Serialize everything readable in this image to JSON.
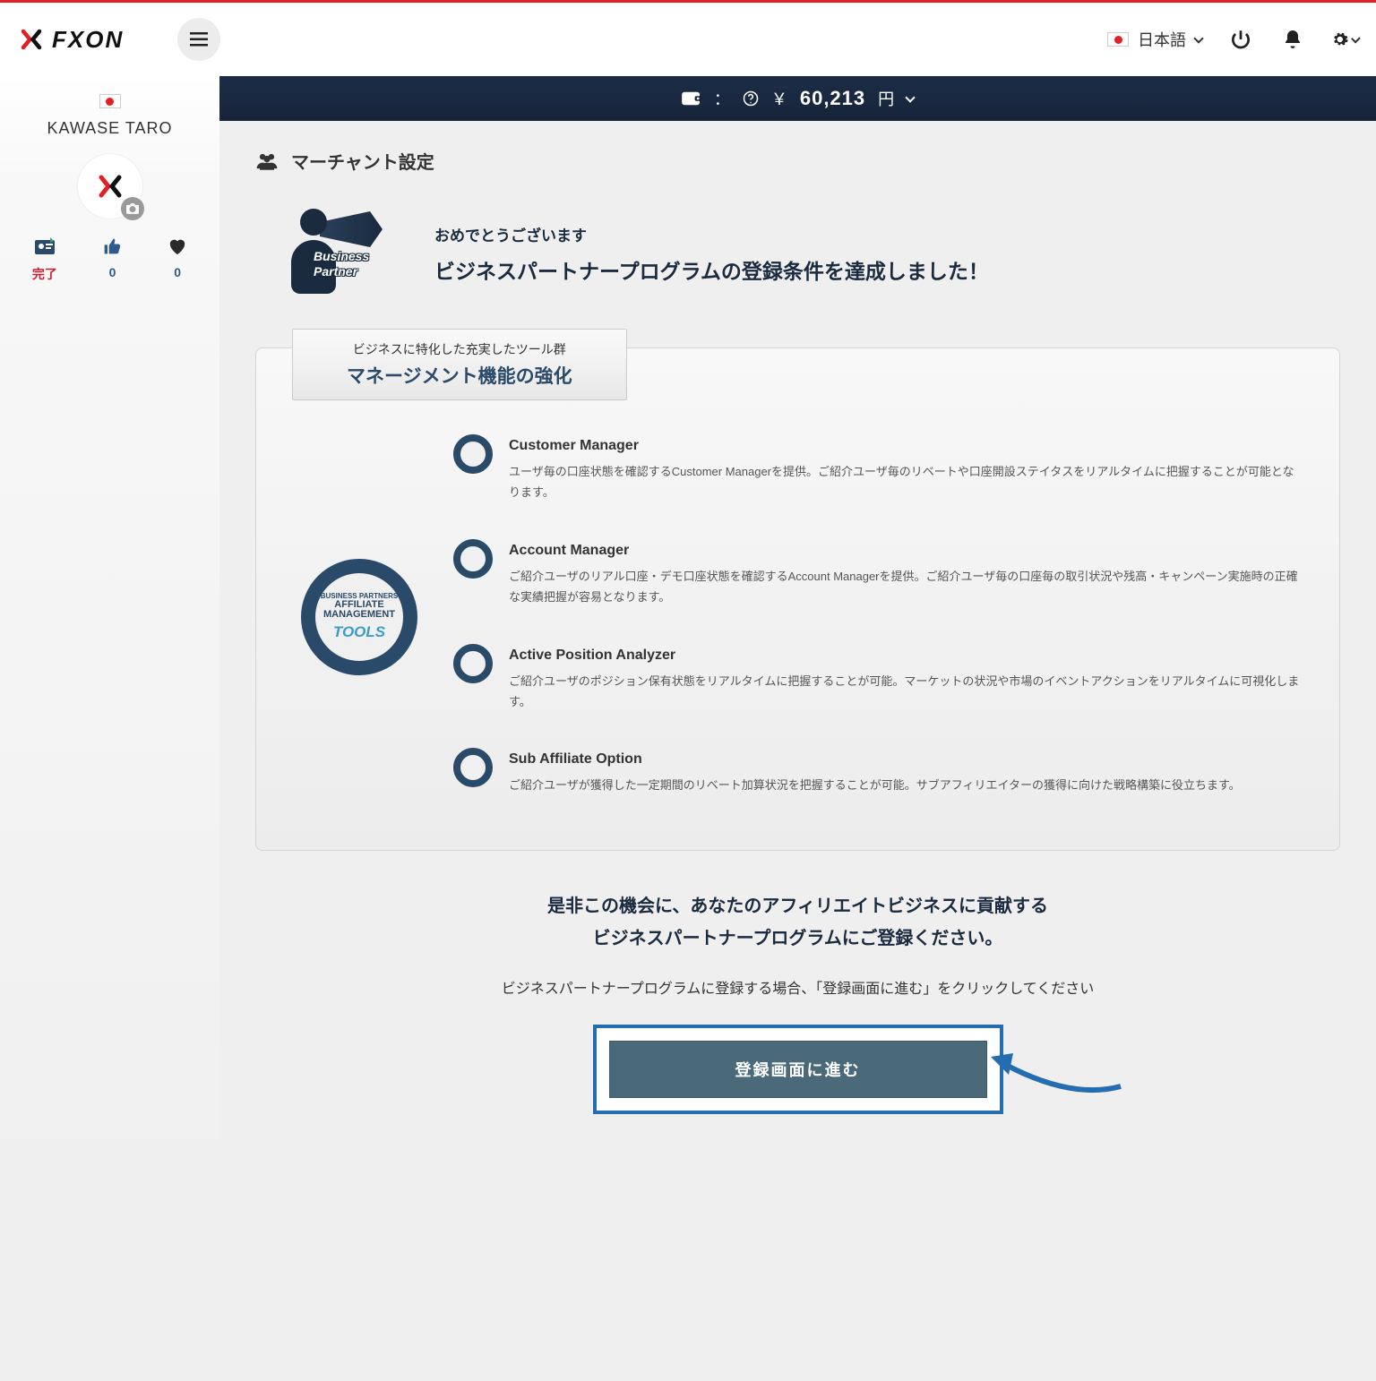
{
  "header": {
    "brand": "FXON",
    "language_label": "日本語"
  },
  "sidebar": {
    "user_name": "KAWASE TARO",
    "stats": {
      "complete_label": "完了",
      "thumbs": "0",
      "hearts": "0"
    }
  },
  "balance_bar": {
    "currency_symbol": "￥",
    "amount": "60,213",
    "unit": "円"
  },
  "page": {
    "title": "マーチャント設定"
  },
  "congrats": {
    "figure_line1": "Business",
    "figure_line2": "Partner",
    "sub": "おめでとうございます",
    "main": "ビジネスパートナープログラムの登録条件を達成しました！"
  },
  "feature": {
    "badge_sub": "ビジネスに特化した充実したツール群",
    "badge_main": "マネージメント機能の強化",
    "hub_label1": "BUSINESS PARTNERS",
    "hub_label2": "AFFILIATE MANAGEMENT",
    "hub_label3": "TOOLS",
    "tools": [
      {
        "title": "Customer Manager",
        "desc": "ユーザ毎の口座状態を確認するCustomer Managerを提供。ご紹介ユーザ毎のリベートや口座開設ステイタスをリアルタイムに把握することが可能となります。"
      },
      {
        "title": "Account Manager",
        "desc": "ご紹介ユーザのリアル口座・デモ口座状態を確認するAccount Managerを提供。ご紹介ユーザ毎の口座毎の取引状況や残高・キャンペーン実施時の正確な実績把握が容易となります。"
      },
      {
        "title": "Active Position Analyzer",
        "desc": "ご紹介ユーザのポジション保有状態をリアルタイムに把握することが可能。マーケットの状況や市場のイベントアクションをリアルタイムに可視化します。"
      },
      {
        "title": "Sub Affiliate Option",
        "desc": "ご紹介ユーザが獲得した一定期間のリベート加算状況を把握することが可能。サブアフィリエイターの獲得に向けた戦略構築に役立ちます。"
      }
    ]
  },
  "cta": {
    "line1": "是非この機会に、あなたのアフィリエイトビジネスに貢献する",
    "line2": "ビジネスパートナープログラムにご登録ください。",
    "instruction": "ビジネスパートナープログラムに登録する場合、「登録画面に進む」をクリックしてください",
    "button": "登録画面に進む"
  }
}
